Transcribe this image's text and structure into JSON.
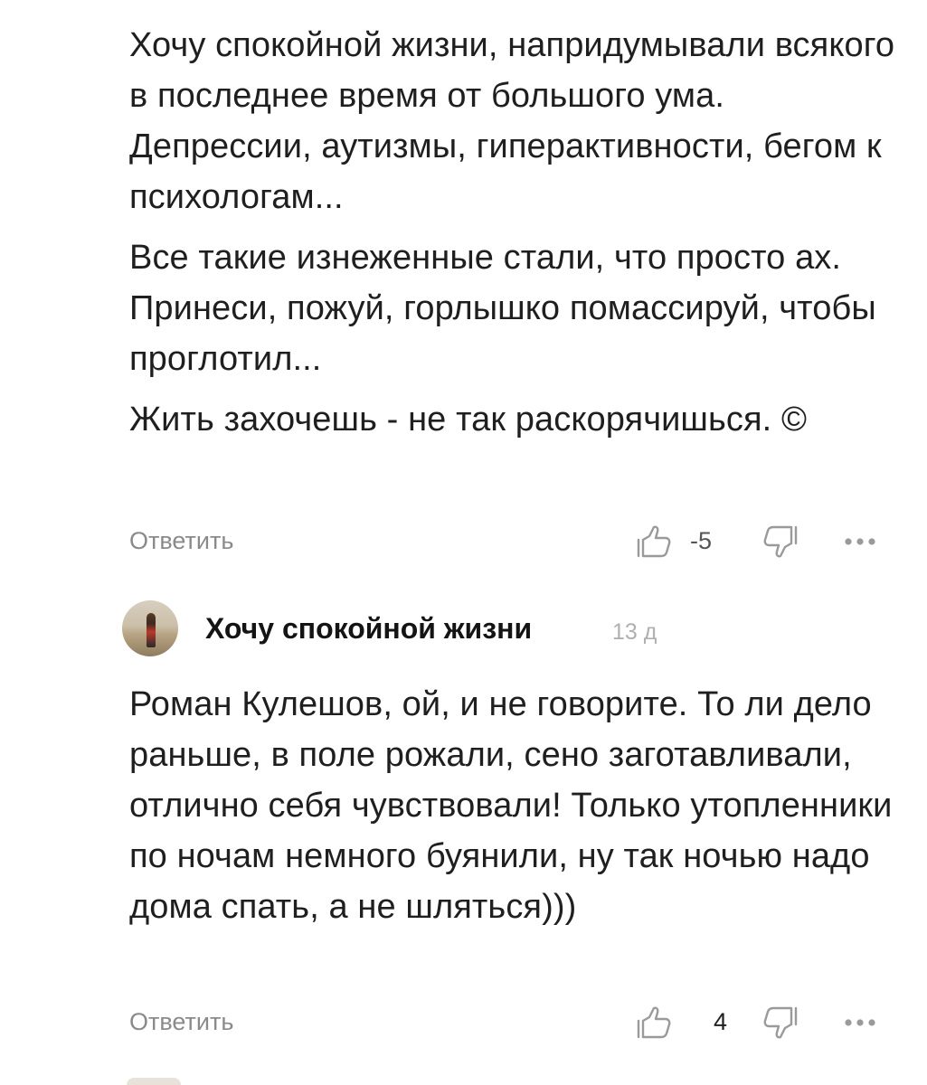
{
  "comments": [
    {
      "paragraphs": [
        "Хочу спокойной жизни, напридумывали всякого в последнее время от большого ума. Депрессии, аутизмы, гиперактивности, бегом к психологам...",
        "Все такие изнеженные стали, что просто ах. Принеси, пожуй, горлышко помассируй, чтобы проглотил...",
        "Жить захочешь - не так раскорячишься. ©"
      ],
      "reply_label": "Ответить",
      "rating": "-5",
      "like_icon": "thumb-up-icon",
      "dislike_icon": "thumb-down-icon",
      "more_icon": "more-dots-icon"
    },
    {
      "author": "Хочу спокойной жизни",
      "age": "13 д",
      "avatar": "avatar-photo",
      "paragraphs": [
        "Роман Кулешов, ой, и не говорите. То ли дело раньше, в поле рожали, сено заготавливали, отлично себя чувствовали! Только утопленники по ночам немного буянили, ну так ночью надо дома спать, а не шляться)))"
      ],
      "reply_label": "Ответить",
      "rating": "4",
      "like_icon": "thumb-up-icon",
      "dislike_icon": "thumb-down-icon",
      "more_icon": "more-dots-icon"
    }
  ],
  "colors": {
    "text": "#1f1f1f",
    "muted": "#8a8a8a",
    "timestamp": "#b0b0b0",
    "icon": "#9a9a9a"
  }
}
